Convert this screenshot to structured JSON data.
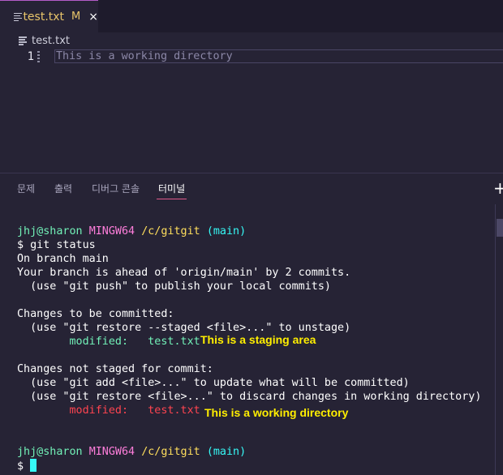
{
  "editor_tab": {
    "filename": "test.txt",
    "status": "M",
    "close_glyph": "×"
  },
  "breadcrumb": {
    "file": "test.txt"
  },
  "editor": {
    "line_number": "1",
    "line_text": "This is a working directory"
  },
  "panel": {
    "tabs": [
      "문제",
      "출력",
      "디버그 콘솔",
      "터미널"
    ],
    "active_tab": "터미널",
    "plus_glyph": "+"
  },
  "terminal": {
    "prompt_user": "jhj@sharon",
    "prompt_host": "MINGW64",
    "prompt_path": "/c/gitgit",
    "prompt_branch": "(main)",
    "command": "$ git status",
    "line_on_branch": "On branch main",
    "line_ahead": "Your branch is ahead of 'origin/main' by 2 commits.",
    "line_push_hint": "  (use \"git push\" to publish your local commits)",
    "staged_header": "Changes to be committed:",
    "staged_hint": "  (use \"git restore --staged <file>...\" to unstage)",
    "staged_label": "        modified:   ",
    "staged_file": "test.txt",
    "staged_note": "This is a staging area",
    "unstaged_header": "Changes not staged for commit:",
    "unstaged_hint1": "  (use \"git add <file>...\" to update what will be committed)",
    "unstaged_hint2": "  (use \"git restore <file>...\" to discard changes in working directory)",
    "unstaged_label": "        modified:   ",
    "unstaged_file": "test.txt",
    "unstaged_note": "This is a working directory",
    "final_prompt": "$ "
  },
  "colors": {
    "background": "#262335",
    "prompt_user": "#72f1b8",
    "prompt_host": "#ff7edb",
    "prompt_path": "#fede5d",
    "prompt_branch": "#36f9f6",
    "staged": "#72f1b8",
    "unstaged": "#fe4450",
    "note": "#ffee00"
  },
  "icons": {
    "tab_file": "file-lines-icon",
    "breadcrumb_file": "file-lines-icon"
  }
}
